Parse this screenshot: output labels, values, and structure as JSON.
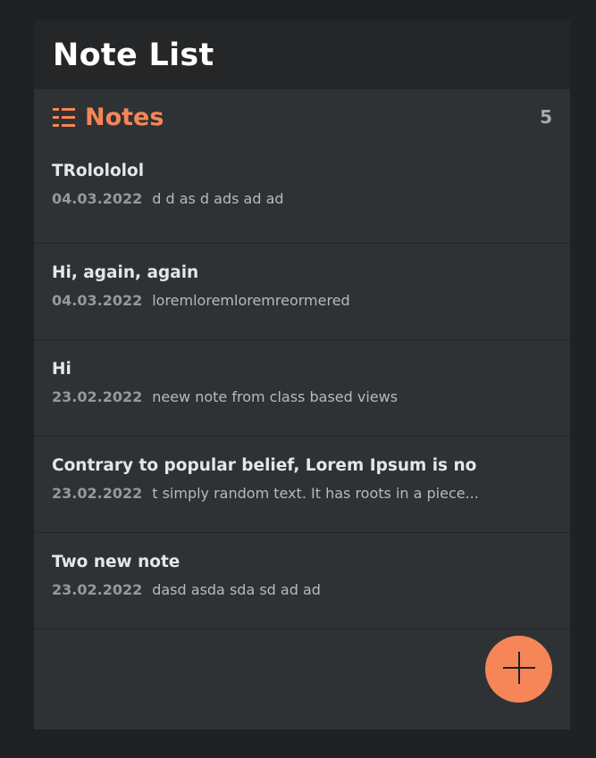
{
  "header": {
    "title": "Note List"
  },
  "notes_section": {
    "icon": "list-icon",
    "title": "Notes",
    "count": "5"
  },
  "notes": [
    {
      "title": "TRolololol",
      "date": "04.03.2022",
      "preview": "d d as d ads ad ad"
    },
    {
      "title": "Hi, again, again",
      "date": "04.03.2022",
      "preview": "loremloremloremreormered"
    },
    {
      "title": "Hi",
      "date": "23.02.2022",
      "preview": "neew note from class based views"
    },
    {
      "title": "Contrary to popular belief, Lorem Ipsum is no",
      "date": "23.02.2022",
      "preview": "t simply random text. It has roots in a piece..."
    },
    {
      "title": "Two new note",
      "date": "23.02.2022",
      "preview": "dasd asda sda sd ad ad"
    }
  ],
  "add_button": {
    "icon": "plus-icon"
  },
  "colors": {
    "accent": "#f68657",
    "background": "#1f2124",
    "panel": "#2e3235",
    "header": "#242628"
  }
}
